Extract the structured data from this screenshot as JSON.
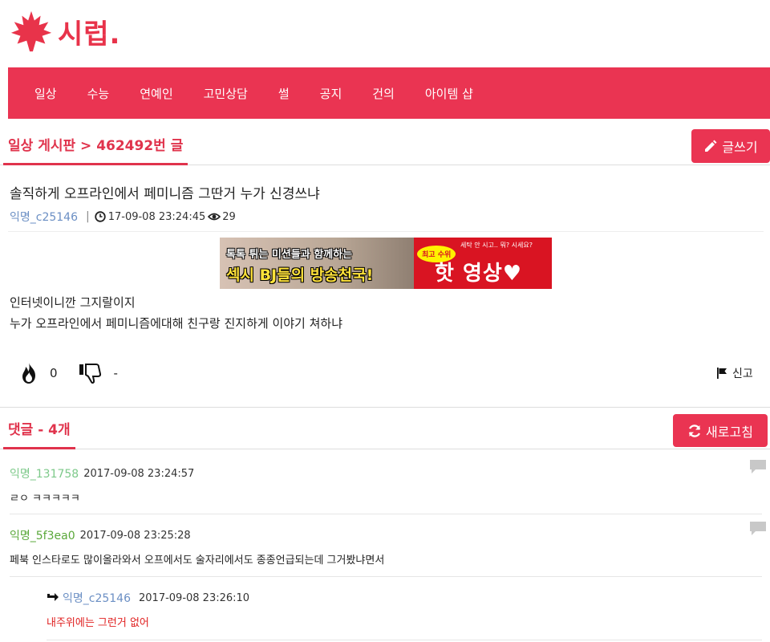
{
  "site": {
    "logo_text": "시럽."
  },
  "nav": {
    "items": [
      "일상",
      "수능",
      "연예인",
      "고민상담",
      "썰",
      "공지",
      "건의",
      "아이템 샵"
    ]
  },
  "board": {
    "title": "일상 게시판 > 462492번 글",
    "write_label": "글쓰기"
  },
  "post": {
    "title": "솔직하게 오프라인에서 페미니즘 그딴거 누가 신경쓰냐",
    "author": "익명_c25146",
    "date": "17-09-08 23:24:45",
    "views": "29",
    "body": [
      "인터넷이니깐 그지랄이지",
      "누가 오프라인에서 페미니즘에대해 친구랑 진지하게 이야기 쳐하냐"
    ],
    "likes": "0",
    "dislikes": "-",
    "report_label": "신고"
  },
  "ad": {
    "line1": "톡톡 튀는 미션들과 함께하는",
    "line2": "섹시 BJ들의 방송천국!",
    "badge": "최고 수위",
    "small": "세탁 안 시고.. 뭐? 시세요?",
    "big": "핫 영상♥"
  },
  "comments_section": {
    "title": "댓글 - 4개",
    "refresh_label": "새로고침"
  },
  "comments": [
    {
      "author": "익명_131758",
      "date": "2017-09-08 23:24:57",
      "text": "ㄹㅇ ㅋㅋㅋㅋㅋ",
      "color": "#7dc98a"
    },
    {
      "author": "익명_5f3ea0",
      "date": "2017-09-08 23:25:28",
      "text": "페북 인스타로도 많이올라와서 오프에서도 술자리에서도 종종언급되는데 그거봤냐면서",
      "color": "#5aa83a"
    }
  ],
  "reply": {
    "author": "익명_c25146",
    "date": "2017-09-08 23:26:10",
    "text": "내주위에는 그런거 없어",
    "author_color": "#6b8fc4",
    "text_color": "#e02020"
  },
  "colors": {
    "accent": "#ea3452"
  }
}
